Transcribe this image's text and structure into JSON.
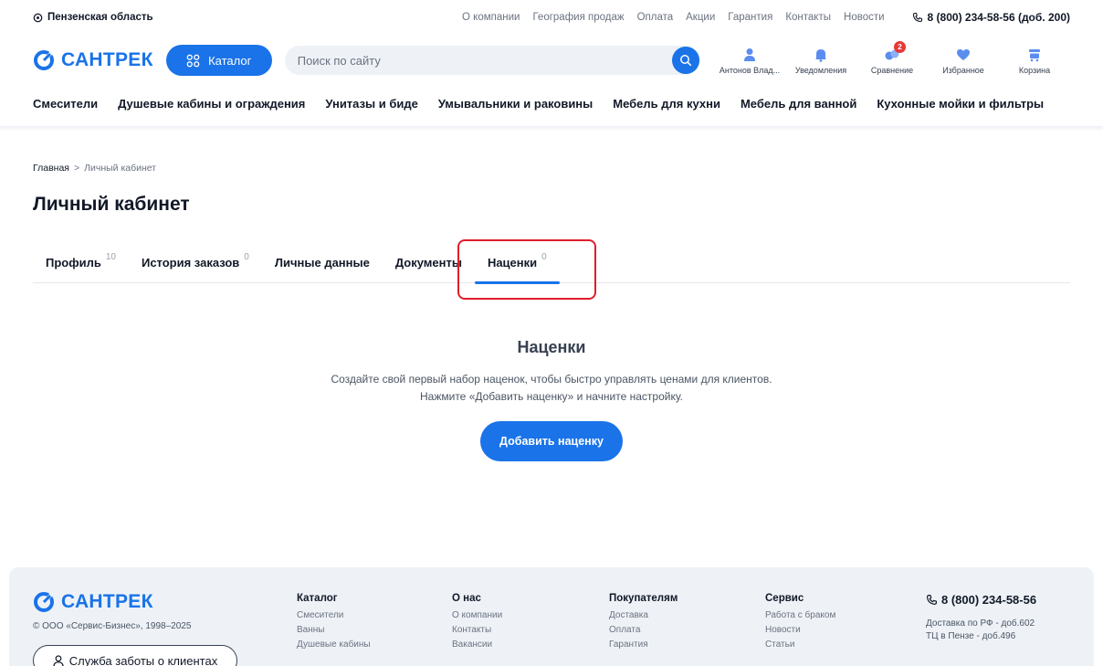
{
  "topbar": {
    "region": "Пензенская область",
    "links": [
      "О компании",
      "География продаж",
      "Оплата",
      "Акции",
      "Гарантия",
      "Контакты",
      "Новости"
    ],
    "phone": "8 (800) 234-58-56 (доб. 200)"
  },
  "header": {
    "logo_text": "САНТРЕК",
    "catalog_label": "Каталог",
    "search_placeholder": "Поиск по сайту",
    "icons": [
      {
        "name": "user-icon",
        "label": "Антонов Влад..."
      },
      {
        "name": "bell-icon",
        "label": "Уведомления"
      },
      {
        "name": "compare-icon",
        "label": "Сравнение",
        "badge": "2"
      },
      {
        "name": "heart-icon",
        "label": "Избранное"
      },
      {
        "name": "cart-icon",
        "label": "Корзина"
      }
    ],
    "accent": "#1a73e8",
    "badge_color": "#e53935"
  },
  "categories": [
    "Смесители",
    "Душевые кабины и ограждения",
    "Унитазы и биде",
    "Умывальники и раковины",
    "Мебель для кухни",
    "Мебель для ванной",
    "Кухонные мойки и фильтры"
  ],
  "breadcrumb": {
    "home": "Главная",
    "separator": ">",
    "current": "Личный кабинет"
  },
  "page_title": "Личный кабинет",
  "tabs": [
    {
      "label": "Профиль",
      "count": "10"
    },
    {
      "label": "История заказов",
      "count": "0"
    },
    {
      "label": "Личные данные",
      "count": ""
    },
    {
      "label": "Документы",
      "count": ""
    },
    {
      "label": "Наценки",
      "count": "0",
      "active": true
    }
  ],
  "empty_state": {
    "title": "Наценки",
    "line1": "Создайте свой первый набор наценок, чтобы быстро управлять ценами для клиентов.",
    "line2": "Нажмите «Добавить наценку» и начните настройку.",
    "button": "Добавить наценку"
  },
  "footer": {
    "logo_text": "САНТРЕК",
    "copyright": "© ООО «Сервис-Бизнес», 1998–2025",
    "care_button": "Служба заботы о клиентах",
    "columns": [
      {
        "title": "Каталог",
        "links": [
          "Смесители",
          "Ванны",
          "Душевые кабины"
        ]
      },
      {
        "title": "О нас",
        "links": [
          "О компании",
          "Контакты",
          "Вакансии"
        ]
      },
      {
        "title": "Покупателям",
        "links": [
          "Доставка",
          "Оплата",
          "Гарантия"
        ]
      },
      {
        "title": "Сервис",
        "links": [
          "Работа с браком",
          "Новости",
          "Статьи"
        ]
      }
    ],
    "phone": "8 (800) 234-58-56",
    "note1": "Доставка по РФ - доб.602",
    "note2": "ТЦ в Пензе - доб.496"
  }
}
